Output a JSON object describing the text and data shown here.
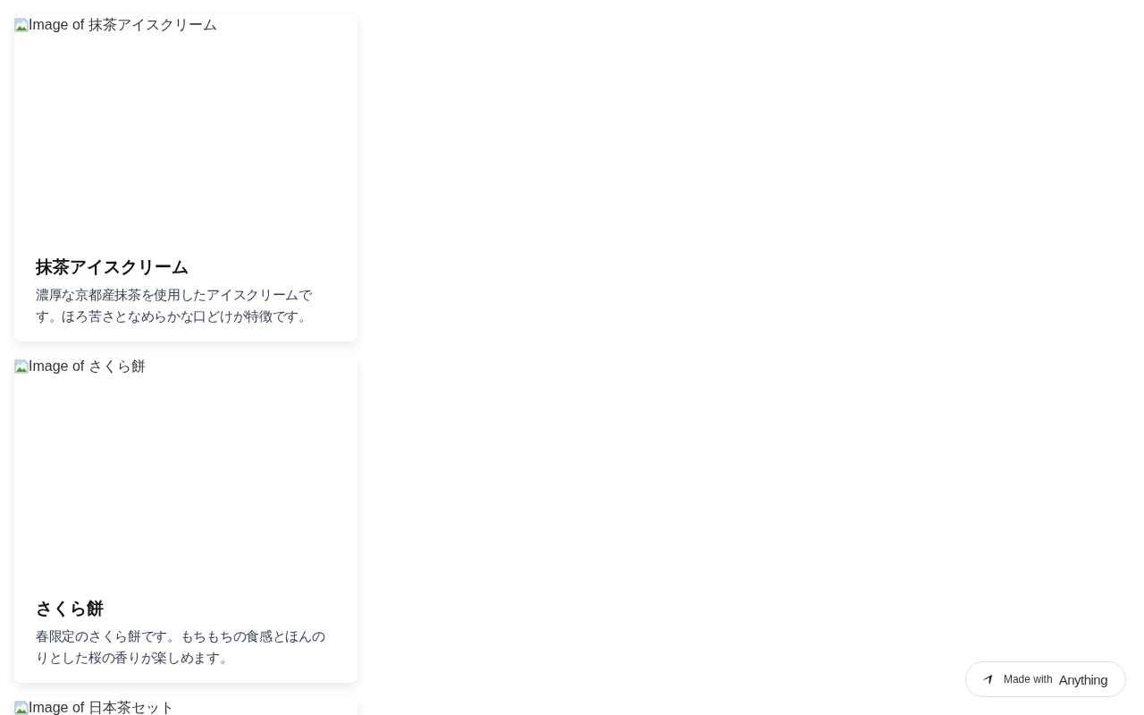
{
  "cards": [
    {
      "image_alt": "Image of 抹茶アイスクリーム",
      "title": "抹茶アイスクリーム",
      "description": "濃厚な京都産抹茶を使用したアイスクリームです。ほろ苦さとなめらかな口どけが特徴です。"
    },
    {
      "image_alt": "Image of さくら餅",
      "title": "さくら餅",
      "description": "春限定のさくら餅です。もちもちの食感とほんのりとした桜の香りが楽しめます。"
    },
    {
      "image_alt": "Image of 日本茶セット"
    }
  ],
  "badge": {
    "label": "Made with",
    "brand": "Anything"
  }
}
